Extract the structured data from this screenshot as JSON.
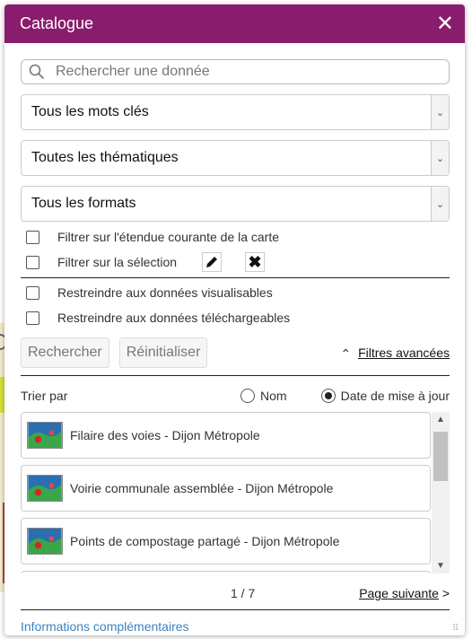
{
  "header": {
    "title": "Catalogue"
  },
  "search": {
    "placeholder": "Rechercher une donnée"
  },
  "filters": {
    "keywords": "Tous les mots clés",
    "themes": "Toutes les thématiques",
    "formats": "Tous les formats"
  },
  "checks": {
    "extent": "Filtrer sur l'étendue courante de la carte",
    "selection": "Filtrer sur la sélection",
    "viewable": "Restreindre aux données visualisables",
    "downloadable": "Restreindre aux données téléchargeables"
  },
  "actions": {
    "search": "Rechercher",
    "reset": "Réinitialiser",
    "advanced": "Filtres avancées"
  },
  "sort": {
    "label": "Trier par",
    "name": "Nom",
    "date": "Date de mise à jour",
    "selected": "date"
  },
  "results": [
    {
      "title": "Filaire des voies - Dijon Métropole"
    },
    {
      "title": "Voirie communale assemblée - Dijon Métropole"
    },
    {
      "title": "Points de compostage partagé - Dijon Métropole"
    },
    {
      "title": ""
    }
  ],
  "pager": {
    "count": "1 / 7",
    "next": "Page suivante",
    "next_arrow": ">"
  },
  "footer": {
    "info": "Informations complémentaires"
  },
  "colors": {
    "header": "#8a1c6d",
    "link": "#3a83c1"
  }
}
